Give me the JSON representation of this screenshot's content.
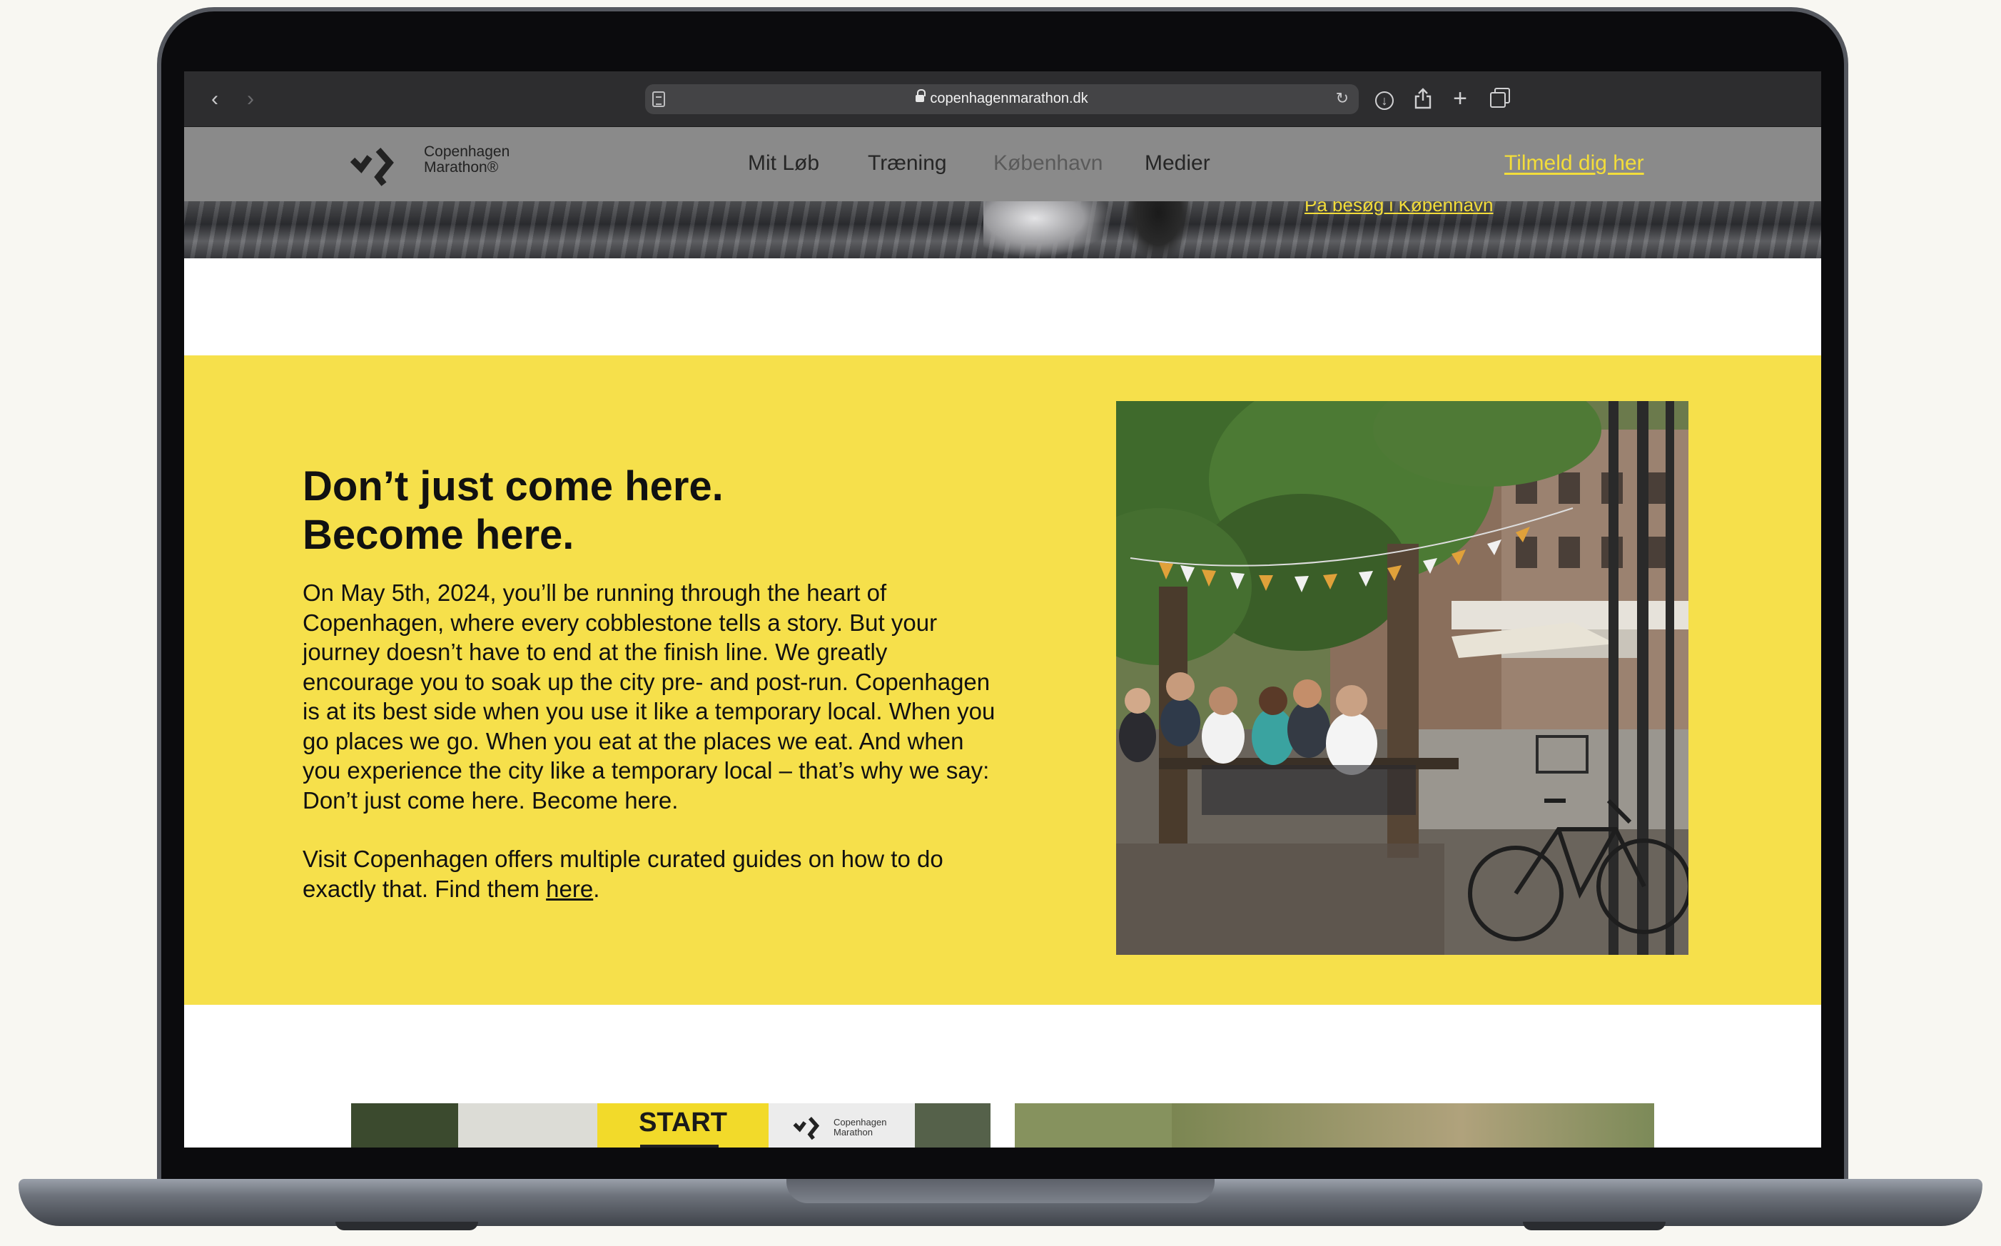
{
  "browser": {
    "url": "copenhagenmarathon.dk",
    "back_icon": "chevron-left-icon",
    "forward_icon": "chevron-right-icon"
  },
  "header": {
    "logo_line1": "Copenhagen",
    "logo_line2": "Marathon®",
    "nav": [
      {
        "label": "Mit Løb"
      },
      {
        "label": "Træning"
      },
      {
        "label": "København"
      },
      {
        "label": "Medier"
      }
    ],
    "cta": "Tilmeld dig her"
  },
  "hero": {
    "link": "På besøg i København"
  },
  "section": {
    "headline_line1": "Don’t just come here.",
    "headline_line2": "Become here.",
    "paragraph1_lines": [
      "On May 5th, 2024, you’ll be running through the heart of",
      "Copenhagen, where every cobblestone tells a story. But your",
      "journey doesn’t have to end at the finish line. We greatly",
      "encourage you to soak up the city pre- and post-run. Copenhagen",
      "is at its best side when you use it like a temporary local. When you",
      "go places we go. When you eat at the places we eat. And when",
      "you experience the city like a temporary local – that’s why we say:",
      "Don’t just come here. Become here."
    ],
    "paragraph2_line1": "Visit Copenhagen offers multiple curated guides on how to do",
    "paragraph2_line2_prefix": "exactly that. Find them ",
    "paragraph2_link": "here",
    "paragraph2_suffix": "."
  },
  "cards": {
    "start_sign": "START",
    "card_logo_line1": "Copenhagen",
    "card_logo_line2": "Marathon"
  },
  "colors": {
    "accent_yellow": "#f6e04b",
    "link_yellow": "#f3dd3a",
    "header_gray": "#8a8a8a"
  }
}
